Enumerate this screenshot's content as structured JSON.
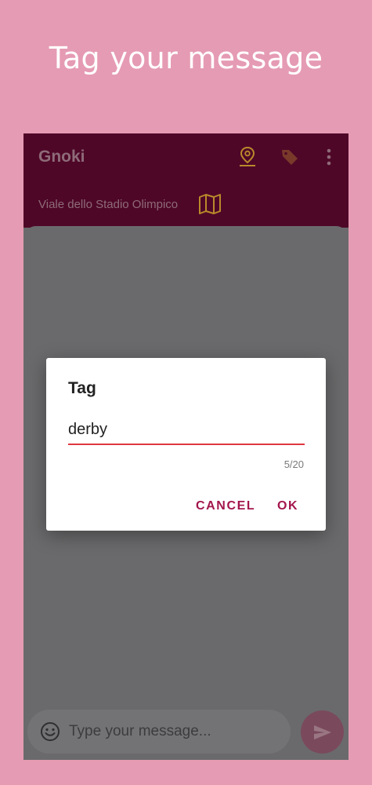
{
  "promo": {
    "title": "Tag your message"
  },
  "app_bar": {
    "title": "Gnoki",
    "location": "Viale dello Stadio Olimpico",
    "icons": [
      "location-pin-icon",
      "tag-icon",
      "more-vert-icon",
      "map-icon"
    ],
    "accent_color": "#b98a2a"
  },
  "dialog": {
    "title": "Tag",
    "input_value": "derby",
    "counter": "5/20",
    "cancel_label": "CANCEL",
    "ok_label": "OK",
    "button_color": "#a3164d",
    "underline_color": "#e0383f"
  },
  "composer": {
    "placeholder": "Type your message...",
    "icons": [
      "emoji-icon",
      "send-icon"
    ]
  },
  "colors": {
    "background": "#e59bb3",
    "app_bar": "#4f0728",
    "scrim": "#6a6a6c"
  }
}
